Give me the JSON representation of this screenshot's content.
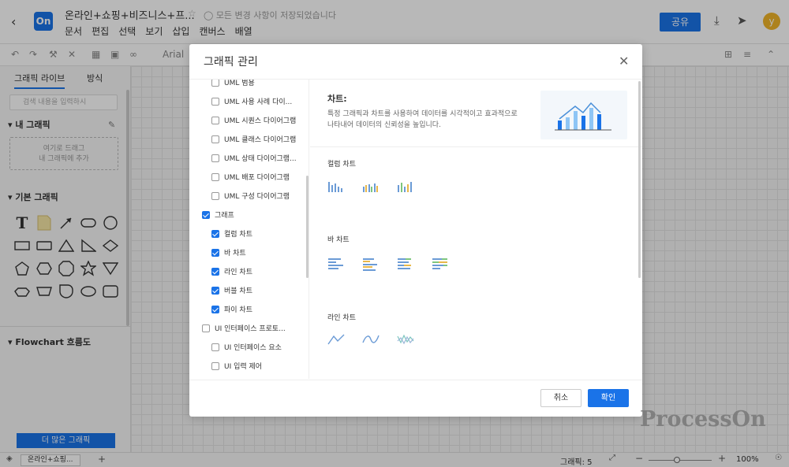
{
  "header": {
    "doc_title": "온라인+쇼핑+비즈니스+프...",
    "saved_status": "모든 변경 사항이 저장되었습니다",
    "logo_text": "On",
    "menu": [
      "문서",
      "편집",
      "선택",
      "보기",
      "삽입",
      "캔버스",
      "배열"
    ],
    "share_label": "공유",
    "avatar_letter": "y"
  },
  "toolbar": {
    "font": "Arial"
  },
  "left_panel": {
    "tabs": [
      "그래픽 라이브",
      "방식"
    ],
    "search_placeholder": "검색 내용을 입력하시",
    "my_graphics": "내 그래픽",
    "drop_hint_1": "여기로 드래그",
    "drop_hint_2": "내 그래픽에 추가",
    "basic_graphics": "기본 그래픽",
    "flowchart": "Flowchart 흐름도",
    "more_button": "더 많은 그래픽"
  },
  "modal": {
    "title": "그래픽 관리",
    "tree": [
      {
        "label": "UML 범용",
        "checked": false,
        "indent": 1
      },
      {
        "label": "UML 사용 사례 다이...",
        "checked": false,
        "indent": 1
      },
      {
        "label": "UML 시퀀스 다이어그램",
        "checked": false,
        "indent": 1
      },
      {
        "label": "UML 클래스 다이어그램",
        "checked": false,
        "indent": 1
      },
      {
        "label": "UML 상태 다이어그램...",
        "checked": false,
        "indent": 1
      },
      {
        "label": "UML 배포 다이어그램",
        "checked": false,
        "indent": 1
      },
      {
        "label": "UML 구성 다이어그램",
        "checked": false,
        "indent": 1
      },
      {
        "label": "그래프",
        "checked": true,
        "indent": 0
      },
      {
        "label": "컬럼 차트",
        "checked": true,
        "indent": 1
      },
      {
        "label": "바 차트",
        "checked": true,
        "indent": 1
      },
      {
        "label": "라인 차트",
        "checked": true,
        "indent": 1
      },
      {
        "label": "버블 차트",
        "checked": true,
        "indent": 1
      },
      {
        "label": "파이 차트",
        "checked": true,
        "indent": 1
      },
      {
        "label": "UI 인터페이스 프로토...",
        "checked": false,
        "indent": 0
      },
      {
        "label": "UI 인터페이스 요소",
        "checked": false,
        "indent": 1
      },
      {
        "label": "UI 입력 제어",
        "checked": false,
        "indent": 1
      }
    ],
    "content_title": "차트:",
    "content_desc": "특정 그래픽과 차트를 사용하여 데이터를 시각적이고 효과적으로 나타내어 데이터의 신뢰성을 높입니다.",
    "categories": [
      "컬럼 차트",
      "바 차트",
      "라인 차트"
    ],
    "cancel": "취소",
    "confirm": "확인"
  },
  "bottom": {
    "page_tab": "온라인+쇼핑...",
    "shapes_count": "그래픽: 5",
    "zoom": "100%"
  },
  "watermark": "ProcessOn",
  "colors": {
    "accent": "#1a73e8"
  }
}
